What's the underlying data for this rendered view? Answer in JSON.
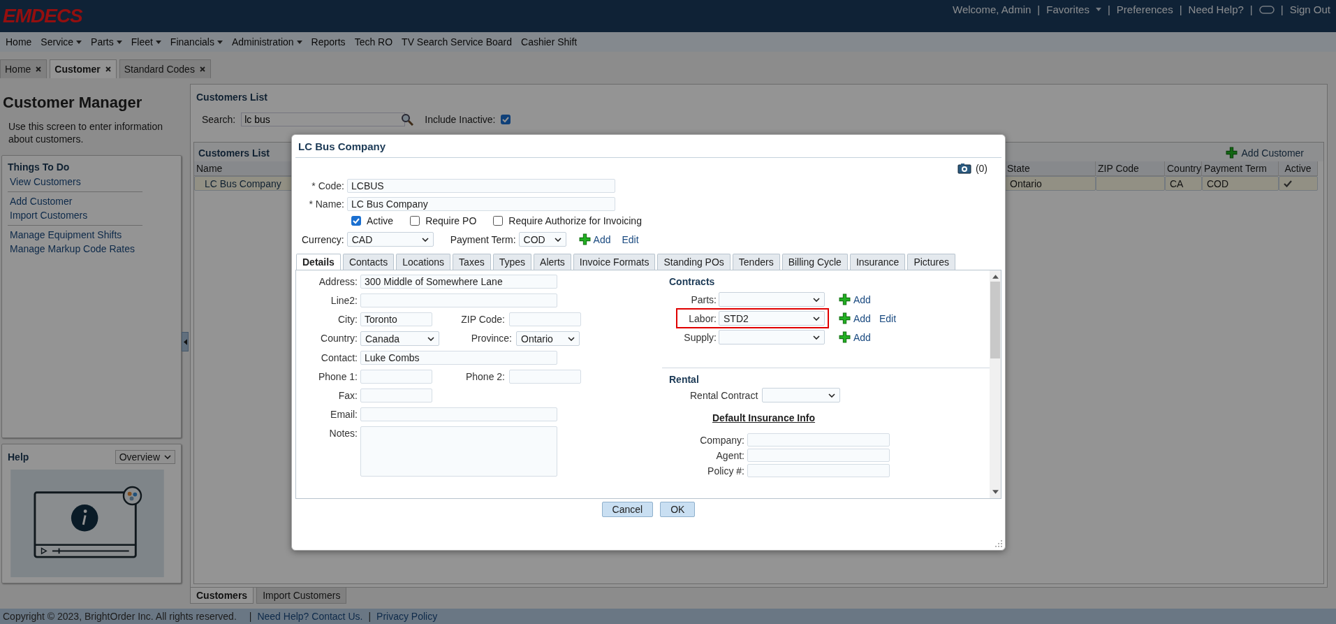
{
  "header": {
    "logo": "EMDECS",
    "items": [
      {
        "kind": "text",
        "label": "Welcome, Admin"
      },
      {
        "kind": "sep",
        "label": "|"
      },
      {
        "kind": "dropdown",
        "label": "Favorites"
      },
      {
        "kind": "sep",
        "label": "|"
      },
      {
        "kind": "link",
        "label": "Preferences"
      },
      {
        "kind": "sep",
        "label": "|"
      },
      {
        "kind": "link",
        "label": "Need Help?"
      },
      {
        "kind": "sep",
        "label": "|"
      },
      {
        "kind": "icon"
      },
      {
        "kind": "sep",
        "label": "|"
      },
      {
        "kind": "link",
        "label": "Sign Out"
      }
    ]
  },
  "menu": [
    {
      "label": "Home",
      "dropdown": false
    },
    {
      "label": "Service",
      "dropdown": true
    },
    {
      "label": "Parts",
      "dropdown": true
    },
    {
      "label": "Fleet",
      "dropdown": true
    },
    {
      "label": "Financials",
      "dropdown": true
    },
    {
      "label": "Administration",
      "dropdown": true
    },
    {
      "label": "Reports",
      "dropdown": false
    },
    {
      "label": "Tech RO",
      "dropdown": false
    },
    {
      "label": "TV Search Service Board",
      "dropdown": false
    },
    {
      "label": "Cashier Shift",
      "dropdown": false
    }
  ],
  "page_tabs": [
    {
      "label": "Home",
      "selected": false
    },
    {
      "label": "Customer",
      "selected": true
    },
    {
      "label": "Standard Codes",
      "selected": false
    }
  ],
  "sidebar": {
    "title": "Customer Manager",
    "description": "Use this screen to enter information about customers.",
    "things_to_do": {
      "title": "Things To Do",
      "groups": [
        [
          "View Customers"
        ],
        [
          "Add Customer",
          "Import Customers"
        ],
        [
          "Manage Equipment Shifts",
          "Manage Markup Code Rates"
        ]
      ]
    },
    "help": {
      "title": "Help",
      "topic": "Overview"
    }
  },
  "customers_list": {
    "title": "Customers List",
    "search_label": "Search:",
    "search_value": "lc bus",
    "include_inactive_label": "Include Inactive:",
    "include_inactive": true,
    "grid": {
      "title": "Customers List",
      "add_label": "Add Customer",
      "columns": [
        "Name",
        "State",
        "ZIP Code",
        "Country",
        "Payment Term",
        "Active"
      ],
      "rows": [
        {
          "name": "LC Bus Company",
          "state": "Ontario",
          "country": "CA",
          "payment_term": "COD",
          "active": true,
          "selected": true
        }
      ]
    }
  },
  "bottom_tabs": [
    {
      "label": "Customers",
      "selected": true
    },
    {
      "label": "Import Customers",
      "selected": false
    }
  ],
  "footer": [
    {
      "kind": "text",
      "label": "Copyright © 2023, BrightOrder Inc. All rights reserved."
    },
    {
      "kind": "sep",
      "label": "|"
    },
    {
      "kind": "link",
      "label": "Need Help? Contact Us."
    },
    {
      "kind": "sep",
      "label": "|"
    },
    {
      "kind": "link",
      "label": "Privacy Policy"
    }
  ],
  "dialog": {
    "title": "LC Bus Company",
    "attachments": "(0)",
    "fields": [
      {
        "label": "* Code:",
        "value": "LCBUS"
      },
      {
        "label": "* Name:",
        "value": "LC Bus Company"
      }
    ],
    "options": [
      {
        "label": "Active",
        "checked": true
      },
      {
        "label": "Require PO",
        "checked": false
      },
      {
        "label": "Require Authorize for Invoicing",
        "checked": false
      }
    ],
    "currency": {
      "label": "Currency:",
      "value": "CAD"
    },
    "payment_term": {
      "label": "Payment Term:",
      "value": "COD",
      "add": "Add",
      "edit": "Edit"
    },
    "tabs": [
      {
        "label": "Details",
        "selected": true
      },
      {
        "label": "Contacts",
        "selected": false
      },
      {
        "label": "Locations",
        "selected": false
      },
      {
        "label": "Taxes",
        "selected": false
      },
      {
        "label": "Types",
        "selected": false
      },
      {
        "label": "Alerts",
        "selected": false
      },
      {
        "label": "Invoice Formats",
        "selected": false
      },
      {
        "label": "Standing POs",
        "selected": false
      },
      {
        "label": "Tenders",
        "selected": false
      },
      {
        "label": "Billing Cycle",
        "selected": false
      },
      {
        "label": "Insurance",
        "selected": false
      },
      {
        "label": "Pictures",
        "selected": false
      }
    ],
    "details": {
      "left": [
        [
          {
            "label": "Address:",
            "value": "300 Middle of Somewhere Lane",
            "kind": "text"
          }
        ],
        [
          {
            "label": "Line2:",
            "kind": "text"
          }
        ],
        [
          {
            "label": "City:",
            "value": "Toronto",
            "kind": "short"
          },
          {
            "label": "ZIP Code:",
            "kind": "short"
          }
        ],
        [
          {
            "label": "Country:",
            "value": "Canada",
            "kind": "select"
          },
          {
            "label": "Province:",
            "value": "Ontario",
            "kind": "select"
          }
        ],
        [
          {
            "label": "Contact:",
            "value": "Luke Combs",
            "kind": "text"
          }
        ],
        [
          {
            "label": "Phone 1:",
            "kind": "short"
          },
          {
            "label": "Phone 2:",
            "kind": "short"
          }
        ],
        [
          {
            "label": "Fax:",
            "kind": "short"
          }
        ],
        [
          {
            "label": "Email:",
            "kind": "text"
          }
        ],
        [
          {
            "label": "Notes:",
            "kind": "textarea"
          }
        ]
      ],
      "contracts": {
        "title": "Contracts",
        "rows": [
          {
            "label": "Parts:",
            "add": "Add",
            "highlighted": false
          },
          {
            "label": "Labor:",
            "value": "STD2",
            "add": "Add",
            "edit": "Edit",
            "highlighted": true
          },
          {
            "label": "Supply:",
            "add": "Add",
            "highlighted": false
          }
        ]
      },
      "rental": {
        "title": "Rental",
        "contract_label": "Rental Contract",
        "insurance_title": "Default Insurance Info",
        "fields": [
          {
            "label": "Company:"
          },
          {
            "label": "Agent:"
          },
          {
            "label": "Policy #:"
          }
        ]
      }
    },
    "buttons": [
      "Cancel",
      "OK"
    ]
  }
}
